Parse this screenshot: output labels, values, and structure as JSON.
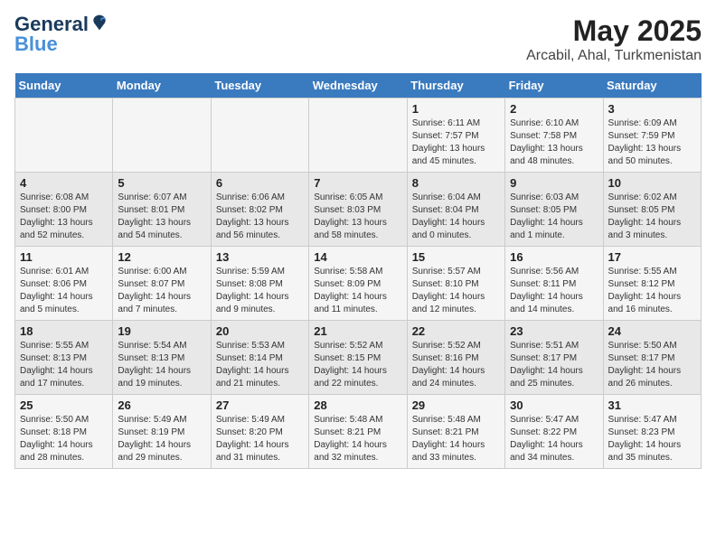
{
  "logo": {
    "text_general": "General",
    "text_blue": "Blue"
  },
  "title": "May 2025",
  "subtitle": "Arcabil, Ahal, Turkmenistan",
  "days_header": [
    "Sunday",
    "Monday",
    "Tuesday",
    "Wednesday",
    "Thursday",
    "Friday",
    "Saturday"
  ],
  "weeks": [
    [
      {
        "num": "",
        "info": ""
      },
      {
        "num": "",
        "info": ""
      },
      {
        "num": "",
        "info": ""
      },
      {
        "num": "",
        "info": ""
      },
      {
        "num": "1",
        "info": "Sunrise: 6:11 AM\nSunset: 7:57 PM\nDaylight: 13 hours\nand 45 minutes."
      },
      {
        "num": "2",
        "info": "Sunrise: 6:10 AM\nSunset: 7:58 PM\nDaylight: 13 hours\nand 48 minutes."
      },
      {
        "num": "3",
        "info": "Sunrise: 6:09 AM\nSunset: 7:59 PM\nDaylight: 13 hours\nand 50 minutes."
      }
    ],
    [
      {
        "num": "4",
        "info": "Sunrise: 6:08 AM\nSunset: 8:00 PM\nDaylight: 13 hours\nand 52 minutes."
      },
      {
        "num": "5",
        "info": "Sunrise: 6:07 AM\nSunset: 8:01 PM\nDaylight: 13 hours\nand 54 minutes."
      },
      {
        "num": "6",
        "info": "Sunrise: 6:06 AM\nSunset: 8:02 PM\nDaylight: 13 hours\nand 56 minutes."
      },
      {
        "num": "7",
        "info": "Sunrise: 6:05 AM\nSunset: 8:03 PM\nDaylight: 13 hours\nand 58 minutes."
      },
      {
        "num": "8",
        "info": "Sunrise: 6:04 AM\nSunset: 8:04 PM\nDaylight: 14 hours\nand 0 minutes."
      },
      {
        "num": "9",
        "info": "Sunrise: 6:03 AM\nSunset: 8:05 PM\nDaylight: 14 hours\nand 1 minute."
      },
      {
        "num": "10",
        "info": "Sunrise: 6:02 AM\nSunset: 8:05 PM\nDaylight: 14 hours\nand 3 minutes."
      }
    ],
    [
      {
        "num": "11",
        "info": "Sunrise: 6:01 AM\nSunset: 8:06 PM\nDaylight: 14 hours\nand 5 minutes."
      },
      {
        "num": "12",
        "info": "Sunrise: 6:00 AM\nSunset: 8:07 PM\nDaylight: 14 hours\nand 7 minutes."
      },
      {
        "num": "13",
        "info": "Sunrise: 5:59 AM\nSunset: 8:08 PM\nDaylight: 14 hours\nand 9 minutes."
      },
      {
        "num": "14",
        "info": "Sunrise: 5:58 AM\nSunset: 8:09 PM\nDaylight: 14 hours\nand 11 minutes."
      },
      {
        "num": "15",
        "info": "Sunrise: 5:57 AM\nSunset: 8:10 PM\nDaylight: 14 hours\nand 12 minutes."
      },
      {
        "num": "16",
        "info": "Sunrise: 5:56 AM\nSunset: 8:11 PM\nDaylight: 14 hours\nand 14 minutes."
      },
      {
        "num": "17",
        "info": "Sunrise: 5:55 AM\nSunset: 8:12 PM\nDaylight: 14 hours\nand 16 minutes."
      }
    ],
    [
      {
        "num": "18",
        "info": "Sunrise: 5:55 AM\nSunset: 8:13 PM\nDaylight: 14 hours\nand 17 minutes."
      },
      {
        "num": "19",
        "info": "Sunrise: 5:54 AM\nSunset: 8:13 PM\nDaylight: 14 hours\nand 19 minutes."
      },
      {
        "num": "20",
        "info": "Sunrise: 5:53 AM\nSunset: 8:14 PM\nDaylight: 14 hours\nand 21 minutes."
      },
      {
        "num": "21",
        "info": "Sunrise: 5:52 AM\nSunset: 8:15 PM\nDaylight: 14 hours\nand 22 minutes."
      },
      {
        "num": "22",
        "info": "Sunrise: 5:52 AM\nSunset: 8:16 PM\nDaylight: 14 hours\nand 24 minutes."
      },
      {
        "num": "23",
        "info": "Sunrise: 5:51 AM\nSunset: 8:17 PM\nDaylight: 14 hours\nand 25 minutes."
      },
      {
        "num": "24",
        "info": "Sunrise: 5:50 AM\nSunset: 8:17 PM\nDaylight: 14 hours\nand 26 minutes."
      }
    ],
    [
      {
        "num": "25",
        "info": "Sunrise: 5:50 AM\nSunset: 8:18 PM\nDaylight: 14 hours\nand 28 minutes."
      },
      {
        "num": "26",
        "info": "Sunrise: 5:49 AM\nSunset: 8:19 PM\nDaylight: 14 hours\nand 29 minutes."
      },
      {
        "num": "27",
        "info": "Sunrise: 5:49 AM\nSunset: 8:20 PM\nDaylight: 14 hours\nand 31 minutes."
      },
      {
        "num": "28",
        "info": "Sunrise: 5:48 AM\nSunset: 8:21 PM\nDaylight: 14 hours\nand 32 minutes."
      },
      {
        "num": "29",
        "info": "Sunrise: 5:48 AM\nSunset: 8:21 PM\nDaylight: 14 hours\nand 33 minutes."
      },
      {
        "num": "30",
        "info": "Sunrise: 5:47 AM\nSunset: 8:22 PM\nDaylight: 14 hours\nand 34 minutes."
      },
      {
        "num": "31",
        "info": "Sunrise: 5:47 AM\nSunset: 8:23 PM\nDaylight: 14 hours\nand 35 minutes."
      }
    ]
  ]
}
